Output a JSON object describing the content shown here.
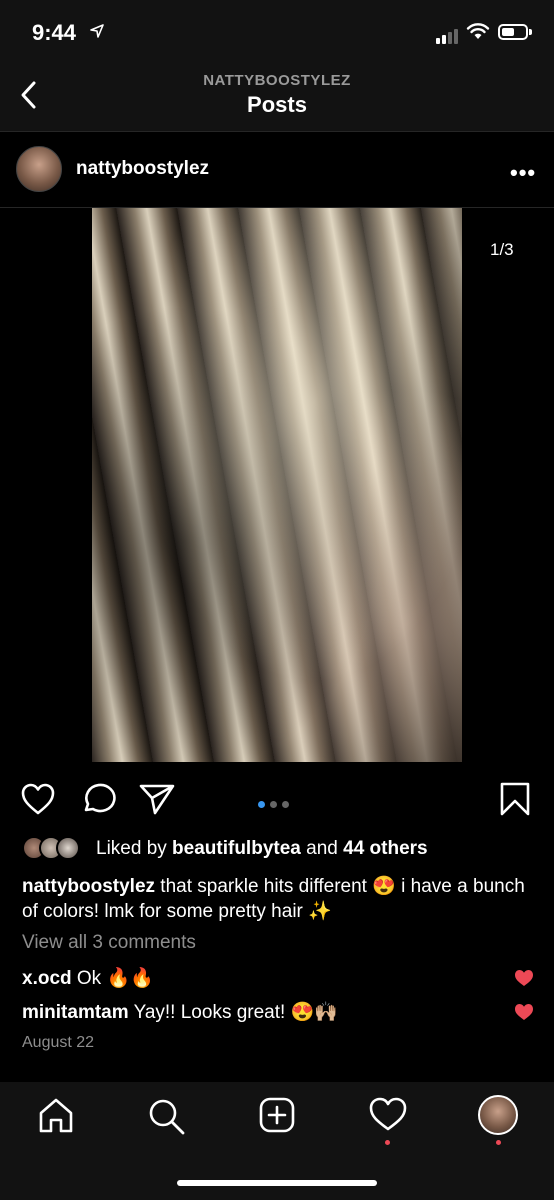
{
  "status": {
    "time": "9:44"
  },
  "nav": {
    "account": "NATTYBOOSTYLEZ",
    "title": "Posts"
  },
  "post": {
    "username": "nattyboostylez",
    "more": "•••",
    "counter": "1/3",
    "liked_prefix": "Liked by ",
    "liked_user": "beautifulbytea",
    "liked_and": " and ",
    "liked_others": "44 others",
    "caption_user": "nattyboostylez",
    "caption_text": " that sparkle hits different 😍 i have a bunch of colors! lmk for some pretty hair ✨",
    "view_all": "View all 3 comments",
    "comments": [
      {
        "user": "x.ocd",
        "text": " Ok 🔥🔥"
      },
      {
        "user": "minitamtam",
        "text": " Yay!! Looks great! 😍🙌🏼"
      }
    ],
    "date": "August 22"
  },
  "colors": {
    "accent": "#3897f0",
    "like": "#ed4956",
    "muted": "#8e8e8e"
  },
  "icons": {
    "back": "chevron-left-icon",
    "like": "heart-icon",
    "comment": "comment-icon",
    "share": "send-icon",
    "save": "bookmark-icon",
    "home": "home-icon",
    "search": "search-icon",
    "new_post": "plus-square-icon",
    "activity": "heart-icon"
  }
}
